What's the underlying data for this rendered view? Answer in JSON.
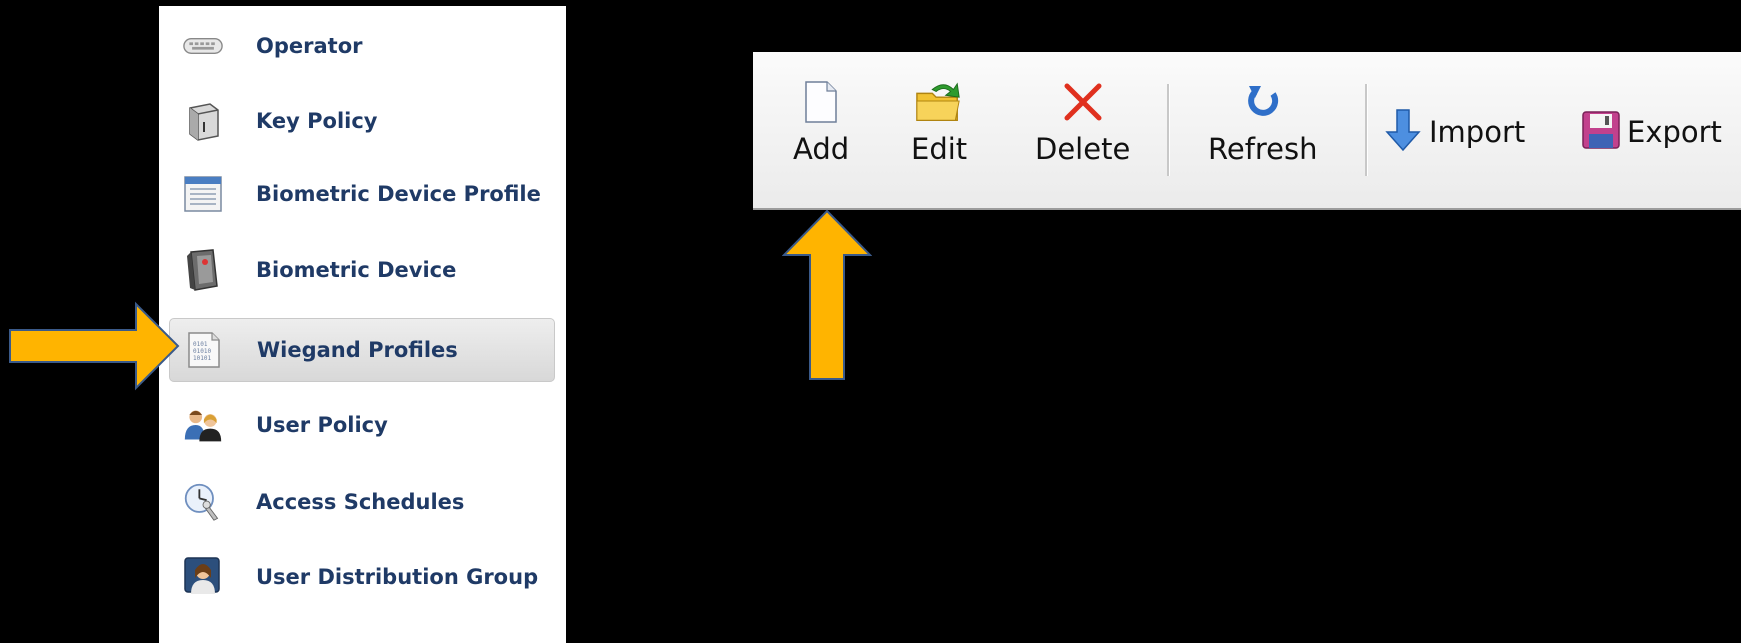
{
  "sidebar": {
    "items": [
      {
        "label": "Operator",
        "icon": "keyboard-icon"
      },
      {
        "label": "Key Policy",
        "icon": "server-key-icon"
      },
      {
        "label": "Biometric Device Profile",
        "icon": "window-list-icon"
      },
      {
        "label": "Biometric Device",
        "icon": "fingerprint-device-icon"
      },
      {
        "label": "Wiegand Profiles",
        "icon": "binary-document-icon",
        "selected": true
      },
      {
        "label": "User Policy",
        "icon": "users-icon"
      },
      {
        "label": "Access Schedules",
        "icon": "clock-key-icon"
      },
      {
        "label": "User Distribution Group",
        "icon": "user-group-icon"
      }
    ]
  },
  "toolbar": {
    "add_label": "Add",
    "edit_label": "Edit",
    "delete_label": "Delete",
    "refresh_label": "Refresh",
    "import_label": "Import",
    "export_label": "Export"
  },
  "colors": {
    "background": "#000000",
    "sidebar_text": "#1f3a66",
    "arrow_fill": "#ffb400",
    "arrow_stroke": "#3a5a8a"
  }
}
